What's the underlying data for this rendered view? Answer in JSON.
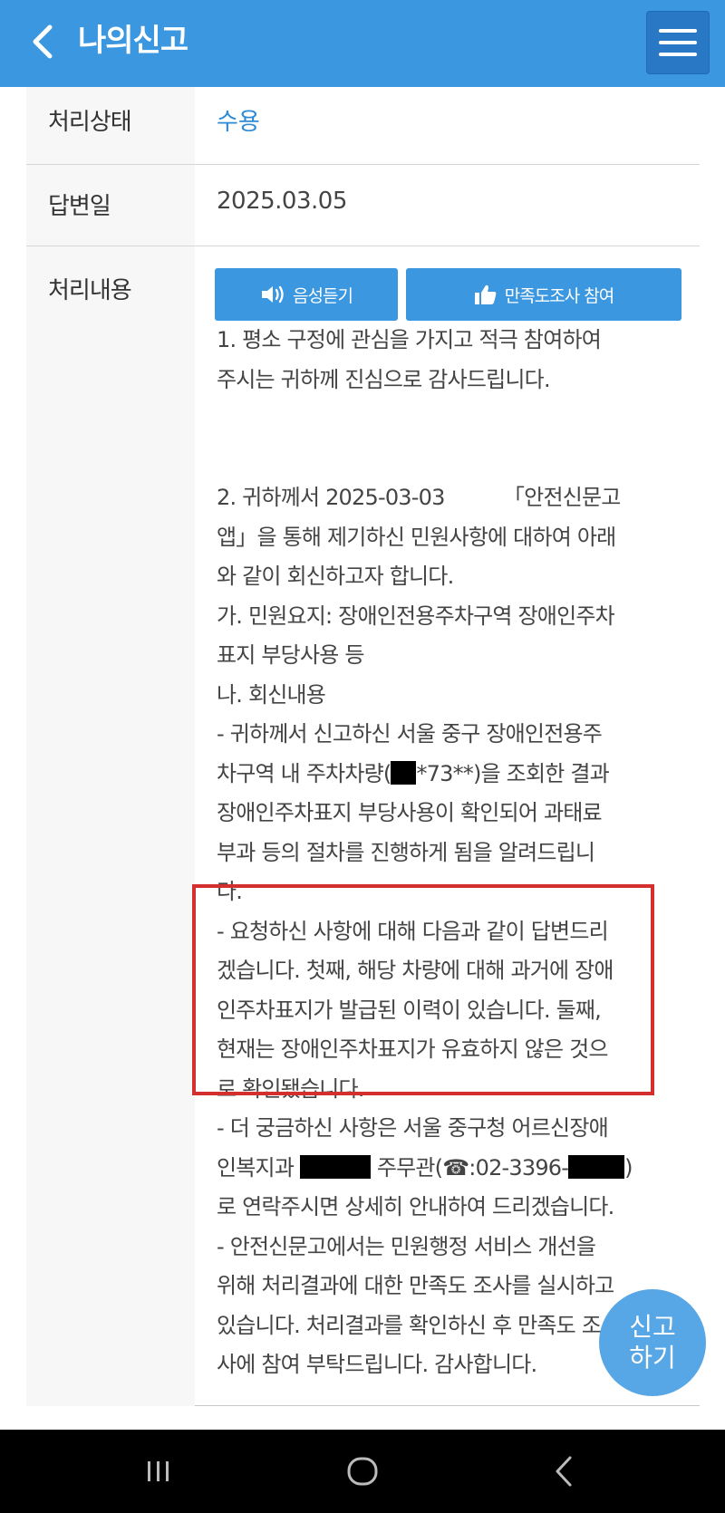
{
  "header": {
    "title": "나의신고",
    "back_icon": "chevron-left-icon",
    "menu_icon": "hamburger-menu-icon"
  },
  "detail": {
    "status": {
      "label": "처리상태",
      "value": "수용"
    },
    "answer_date": {
      "label": "답변일",
      "value": "2025.03.05"
    },
    "content": {
      "label": "처리내용",
      "voice_button": "음성듣기",
      "survey_button": "만족도조사 참여",
      "lines": [
        "1. 평소 구정에 관심을 가지고 적극 참여하여",
        "주시는 귀하께 진심으로 감사드립니다.",
        "2. 귀하께서 2025-03-03 　　　「안전신문고",
        "앱」을 통해 제기하신 민원사항에 대하여 아래",
        "와 같이 회신하고자 합니다.",
        "가. 민원요지: 장애인전용주차구역 장애인주차",
        "표지 부당사용 등",
        "나. 회신내용",
        "- 귀하께서 신고하신 서울 중구 장애인전용주",
        "차구역 내 주차차량(",
        "*73**)을 조회한 결과",
        "장애인주차표지 부당사용이 확인되어 과태료",
        "부과 등의 절차를 진행하게 됨을 알려드립니",
        "다.",
        "- 요청하신 사항에 대해 다음과 같이 답변드리",
        "겠습니다. 첫째, 해당 차량에 대해 과거에 장애",
        "인주차표지가 발급된 이력이 있습니다. 둘째,",
        "현재는 장애인주차표지가 유효하지 않은 것으",
        "로 확인됐습니다.",
        "- 더 궁금하신 사항은 서울 중구청 어르신장애",
        "인복지과",
        "주무관(☎:02-3396-",
        ")",
        "로 연락주시면 상세히 안내하여 드리겠습니다.",
        "- 안전신문고에서는 민원행정 서비스 개선을",
        "위해 처리결과에 대한 만족도 조사를 실시하고",
        "있습니다. 처리결과를 확인하신 후 만족도 조",
        "사에 참여 부탁드립니다. 감사합니다."
      ]
    }
  },
  "fab": {
    "line1": "신고",
    "line2": "하기"
  },
  "colors": {
    "header_bg": "#3a97e0",
    "menu_button_bg": "#2978c6",
    "status_accent": "#2f8ad6",
    "highlight_border": "#d32f2f"
  },
  "nav": {
    "recent_icon": "recent-apps-icon",
    "home_icon": "home-icon",
    "back_icon": "back-icon"
  }
}
